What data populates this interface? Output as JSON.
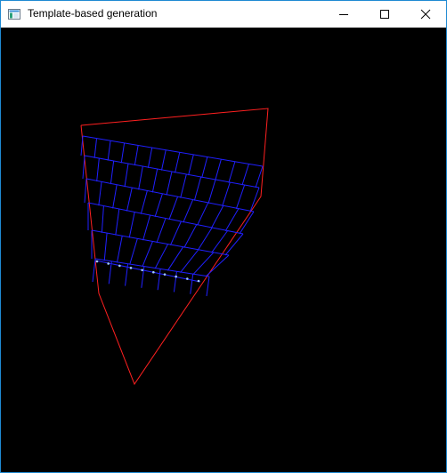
{
  "window": {
    "title": "Template-based generation",
    "app_icon": "window-app-icon",
    "controls": {
      "minimize_icon": "minimize-icon",
      "maximize_icon": "maximize-icon",
      "close_icon": "close-icon"
    }
  },
  "canvas": {
    "background": "#000000",
    "boundary_color": "#ff2020",
    "template_color": "#2020ff",
    "marker_color": "#a0c8ff"
  }
}
